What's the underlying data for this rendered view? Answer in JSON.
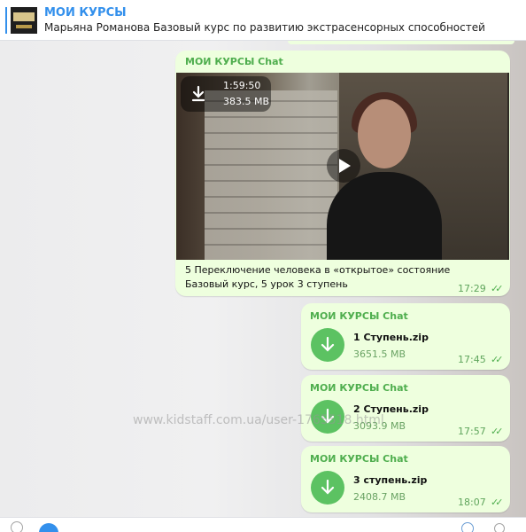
{
  "header": {
    "title": "МОИ КУРСЫ",
    "subtitle": "Марьяна Романова Базовый курс по развитию экстрасенсорных способностей"
  },
  "messages": [
    {
      "sender": "МОИ КУРСЫ Chat",
      "video_duration": "1:59:50",
      "video_size": "383.5 MB",
      "caption_line1": "5 Переключение человека в «открытое» состояние",
      "caption_line2": "Базовый курс, 5 урок 3 ступень",
      "time": "17:29"
    },
    {
      "sender": "МОИ КУРСЫ Chat",
      "file_name": "1 Ступень.zip",
      "file_size": "3651.5 MB",
      "time": "17:45"
    },
    {
      "sender": "МОИ КУРСЫ Chat",
      "file_name": "2 Ступень.zip",
      "file_size": "3093.9 MB",
      "time": "17:57"
    },
    {
      "sender": "МОИ КУРСЫ Chat",
      "file_name": "3 ступень.zip",
      "file_size": "2408.7 MB",
      "time": "18:07"
    }
  ],
  "watermark": "www.kidstaff.com.ua/user-1765518.html",
  "icons": {
    "download": "download-arrow-icon",
    "play": "play-icon",
    "read_receipt": "double-check-icon"
  },
  "colors": {
    "accent": "#3390ec",
    "bubble": "#eeffde",
    "sender": "#4fae4e",
    "download_button": "#5cc262"
  }
}
